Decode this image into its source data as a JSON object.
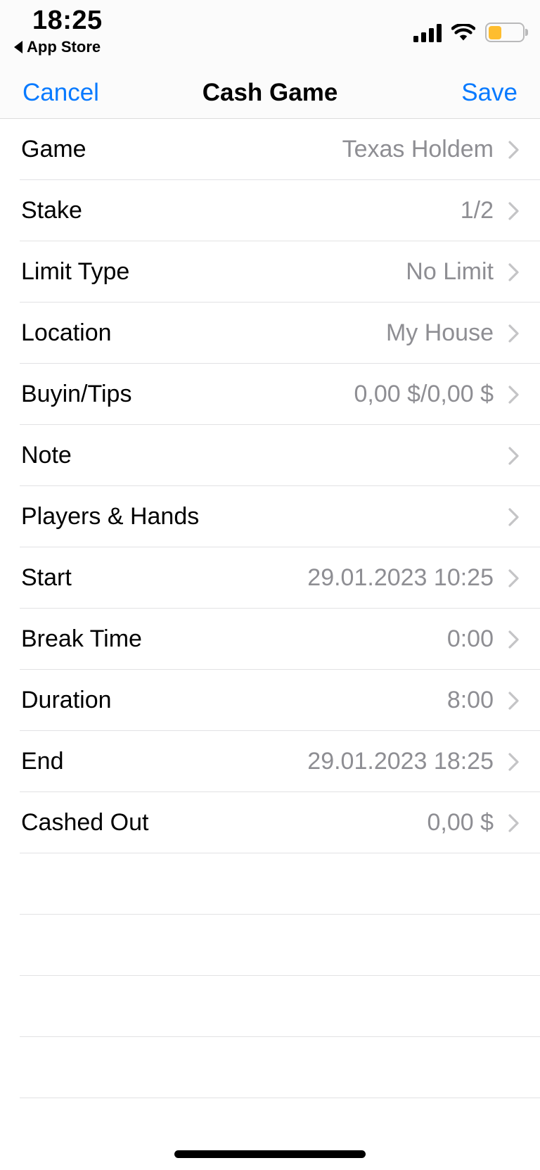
{
  "status_bar": {
    "time": "18:25",
    "back_app_label": "App Store",
    "back_arrow_icon": "triangle-left-icon",
    "signal_icon": "cellular-signal-icon",
    "signal_bars": 4,
    "wifi_icon": "wifi-icon",
    "battery_icon": "battery-icon",
    "battery_fill_percent": 40,
    "battery_color": "#febd2f"
  },
  "nav_bar": {
    "cancel_label": "Cancel",
    "title": "Cash Game",
    "save_label": "Save",
    "accent_color": "#087aff"
  },
  "rows": [
    {
      "label": "Game",
      "value": "Texas Holdem",
      "chevron": "chevron-right-icon"
    },
    {
      "label": "Stake",
      "value": "1/2",
      "chevron": "chevron-right-icon"
    },
    {
      "label": "Limit Type",
      "value": "No Limit",
      "chevron": "chevron-right-icon"
    },
    {
      "label": "Location",
      "value": "My House",
      "chevron": "chevron-right-icon"
    },
    {
      "label": "Buyin/Tips",
      "value": "0,00 $/0,00 $",
      "chevron": "chevron-right-icon"
    },
    {
      "label": "Note",
      "value": "",
      "chevron": "chevron-right-icon"
    },
    {
      "label": "Players & Hands",
      "value": "",
      "chevron": "chevron-right-icon"
    },
    {
      "label": "Start",
      "value": "29.01.2023 10:25",
      "chevron": "chevron-right-icon"
    },
    {
      "label": "Break Time",
      "value": "0:00",
      "chevron": "chevron-right-icon"
    },
    {
      "label": "Duration",
      "value": "8:00",
      "chevron": "chevron-right-icon"
    },
    {
      "label": "End",
      "value": "29.01.2023 18:25",
      "chevron": "chevron-right-icon"
    },
    {
      "label": "Cashed Out",
      "value": "0,00 $",
      "chevron": "chevron-right-icon"
    }
  ],
  "empty_filler_rows": 4,
  "home_indicator": "home-indicator-bar",
  "colors": {
    "label_text": "#000000",
    "value_text": "#8e8e93",
    "separator": "#e2e2e4",
    "chevron": "#c4c4c6",
    "bar_background": "#fbfbfb"
  }
}
